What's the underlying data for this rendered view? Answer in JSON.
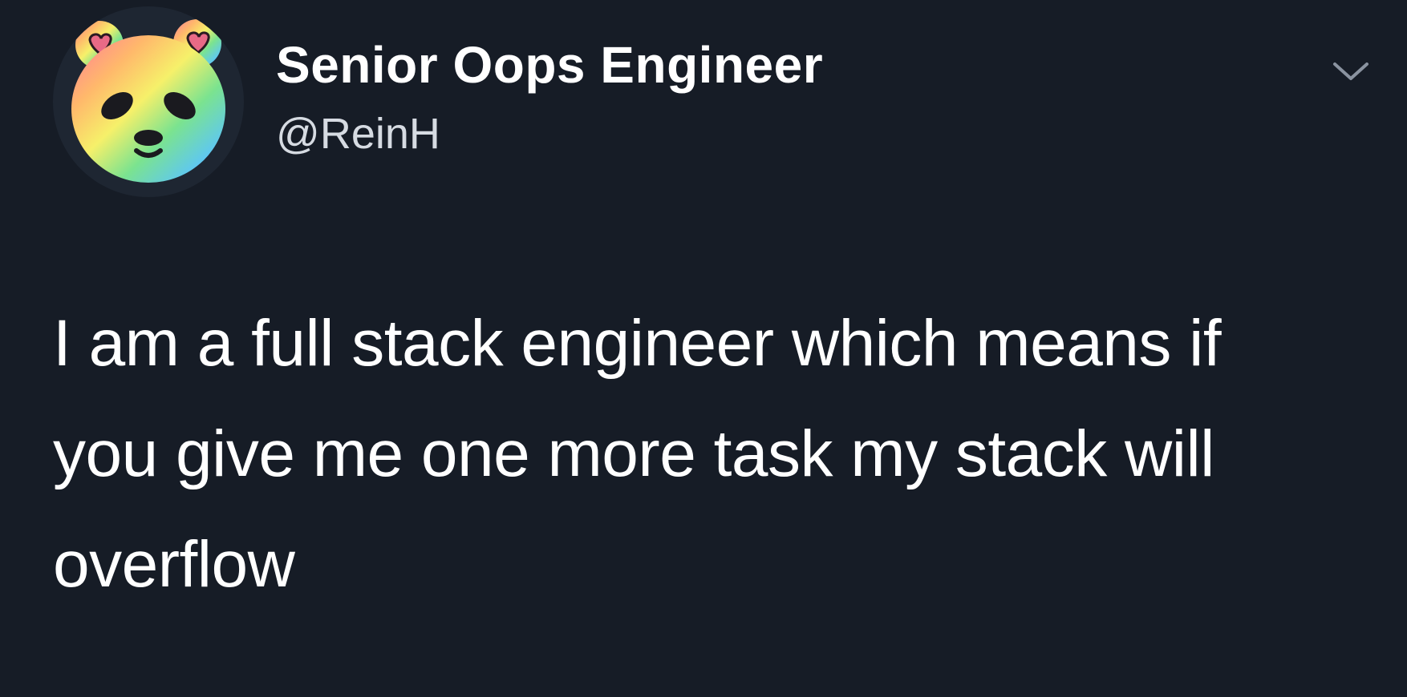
{
  "author": {
    "display_name": "Senior Oops Engineer",
    "handle": "@ReinH",
    "avatar_icon": "rainbow-panda-avatar"
  },
  "menu": {
    "icon": "chevron-down-icon"
  },
  "tweet": {
    "text": "I am a full stack engineer which means if\nyou give me one more task my stack will\noverflow"
  },
  "colors": {
    "background": "#161c26",
    "text_primary": "#ffffff",
    "text_secondary": "#d6dbe2",
    "chevron": "#8a93a0"
  }
}
